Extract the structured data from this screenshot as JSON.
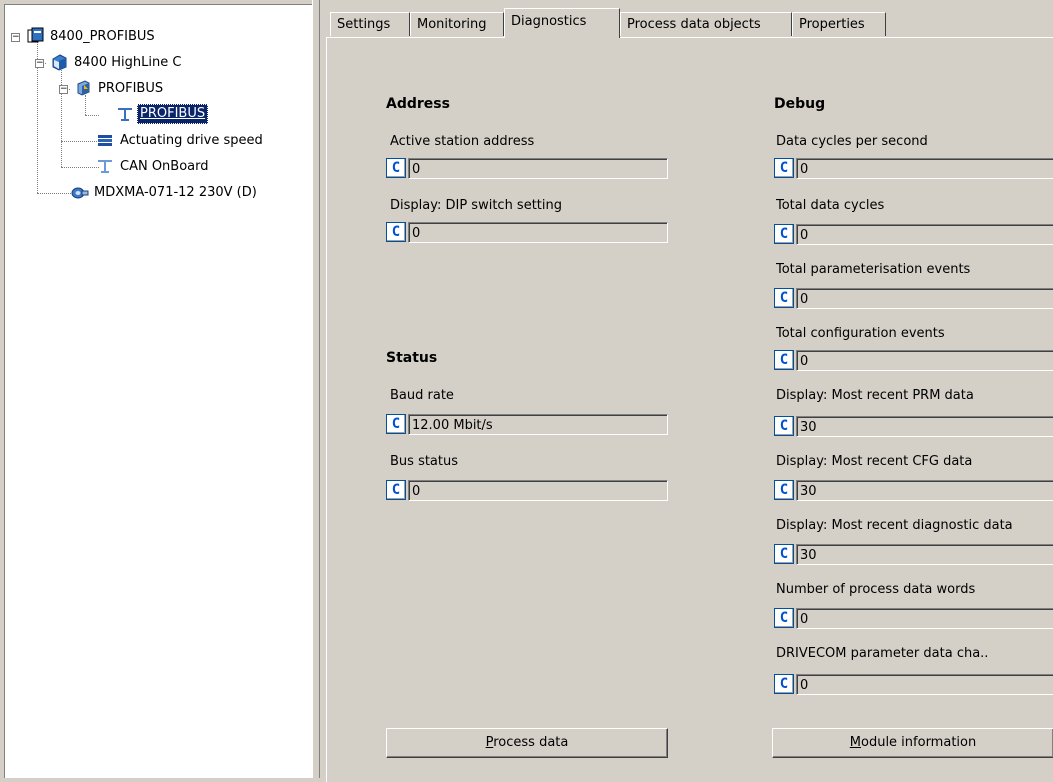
{
  "tree": {
    "root": "8400_PROFIBUS",
    "device": "8400 HighLine C",
    "profibus_group": "PROFIBUS",
    "profibus_item": "PROFIBUS",
    "actuating": "Actuating drive speed",
    "can": "CAN OnBoard",
    "motor": "MDXMA-071-12 230V (D)"
  },
  "tabs": [
    "Settings",
    "Monitoring",
    "Diagnostics",
    "Process data objects",
    "Properties"
  ],
  "active_tab": "Diagnostics",
  "address": {
    "title": "Address",
    "fields": [
      {
        "label": "Active station address",
        "value": "0"
      },
      {
        "label": "Display: DIP switch setting",
        "value": "0"
      }
    ]
  },
  "status": {
    "title": "Status",
    "fields": [
      {
        "label": "Baud rate",
        "value": "12.00 Mbit/s"
      },
      {
        "label": "Bus status",
        "value": "0"
      }
    ]
  },
  "debug": {
    "title": "Debug",
    "fields": [
      {
        "label": "Data cycles per second",
        "value": "0"
      },
      {
        "label": "Total data cycles",
        "value": "0"
      },
      {
        "label": "Total parameterisation events",
        "value": "0"
      },
      {
        "label": "Total configuration events",
        "value": "0"
      },
      {
        "label": "Display: Most recent PRM data",
        "value": "30"
      },
      {
        "label": "Display: Most recent CFG data",
        "value": "30"
      },
      {
        "label": "Display: Most recent diagnostic data",
        "value": "30"
      },
      {
        "label": "Number of process data words",
        "value": "0"
      },
      {
        "label": "DRIVECOM parameter data cha..",
        "value": "0"
      }
    ]
  },
  "c_button_label": "C",
  "buttons": {
    "process_data_hotkey": "P",
    "process_data_rest": "rocess data",
    "module_info_hotkey": "M",
    "module_info_rest": "odule information"
  },
  "expander_minus": "−"
}
